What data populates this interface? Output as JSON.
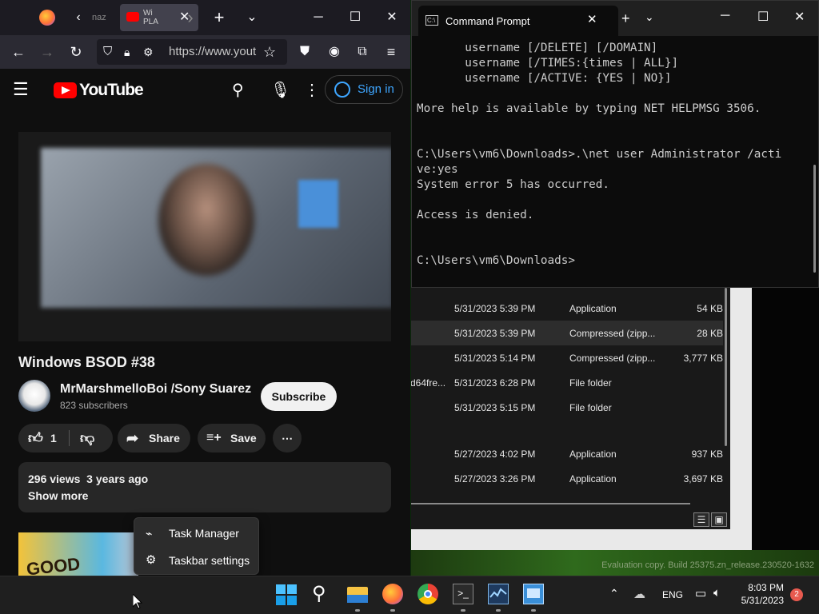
{
  "browser": {
    "tabs": [
      {
        "label": "naz"
      },
      {
        "label": "Wi PLA"
      }
    ],
    "url": "https://www.youtu"
  },
  "youtube": {
    "logo_text": "YouTube",
    "signin_label": "Sign in",
    "video_title": "Windows BSOD #38",
    "channel_name": "MrMarshmelloBoi /Sony Suarez",
    "subscribers": "823 subscribers",
    "subscribe_label": "Subscribe",
    "like_count": "1",
    "share_label": "Share",
    "save_label": "Save",
    "views": "296 views",
    "age": "3 years ago",
    "show_more_label": "Show more",
    "next_thumb_text": "GOOD"
  },
  "cmd": {
    "title": "Command Prompt",
    "output": "       username [/DELETE] [/DOMAIN]\n       username [/TIMES:{times | ALL}]\n       username [/ACTIVE: {YES | NO}]\n\nMore help is available by typing NET HELPMSG 3506.\n\n\nC:\\Users\\vm6\\Downloads>.\\net user Administrator /acti\nve:yes\nSystem error 5 has occurred.\n\nAccess is denied.\n\n\nC:\\Users\\vm6\\Downloads>"
  },
  "explorer": {
    "rows": [
      {
        "name": "",
        "date": "5/31/2023 5:39 PM",
        "type": "Application",
        "size": "54 KB"
      },
      {
        "name": "",
        "date": "5/31/2023 5:39 PM",
        "type": "Compressed (zipp...",
        "size": "28 KB"
      },
      {
        "name": "",
        "date": "5/31/2023 5:14 PM",
        "type": "Compressed (zipp...",
        "size": "3,777 KB"
      },
      {
        "name": "d64fre...",
        "date": "5/31/2023 6:28 PM",
        "type": "File folder",
        "size": ""
      },
      {
        "name": "",
        "date": "5/31/2023 5:15 PM",
        "type": "File folder",
        "size": ""
      },
      {
        "name": "",
        "date": "5/27/2023 4:02 PM",
        "type": "Application",
        "size": "937 KB"
      },
      {
        "name": "",
        "date": "5/27/2023 3:26 PM",
        "type": "Application",
        "size": "3,697 KB"
      }
    ]
  },
  "desktop": {
    "watermark": "Evaluation copy. Build 25375.zn_release.230520-1632"
  },
  "context_menu": {
    "items": [
      {
        "label": "Task Manager",
        "icon": "task-manager-icon"
      },
      {
        "label": "Taskbar settings",
        "icon": "gear-icon"
      }
    ]
  },
  "taskbar": {
    "language": "ENG",
    "time": "8:03 PM",
    "date": "5/31/2023",
    "notification_count": "2"
  }
}
